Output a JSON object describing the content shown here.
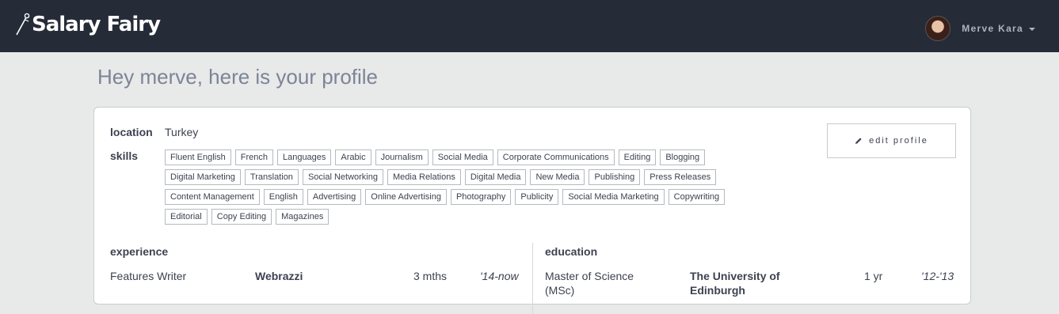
{
  "header": {
    "logo_text": "Salary Fairy",
    "user_name": "Merve Kara"
  },
  "page": {
    "title": "Hey merve, here is your profile"
  },
  "profile": {
    "location_label": "location",
    "location_value": "Turkey",
    "skills_label": "skills",
    "edit_button_label": "edit profile",
    "skills": [
      "Fluent English",
      "French",
      "Languages",
      "Arabic",
      "Journalism",
      "Social Media",
      "Corporate Communications",
      "Editing",
      "Blogging",
      "Digital Marketing",
      "Translation",
      "Social Networking",
      "Media Relations",
      "Digital Media",
      "New Media",
      "Publishing",
      "Press Releases",
      "Content Management",
      "English",
      "Advertising",
      "Online Advertising",
      "Photography",
      "Publicity",
      "Social Media Marketing",
      "Copywriting",
      "Editorial",
      "Copy Editing",
      "Magazines"
    ]
  },
  "experience": {
    "heading": "experience",
    "items": [
      {
        "title": "Features Writer",
        "company": "Webrazzi",
        "duration": "3 mths",
        "period": "'14-now"
      }
    ]
  },
  "education": {
    "heading": "education",
    "items": [
      {
        "degree": "Master of Science (MSc)",
        "school": "The University of Edinburgh",
        "duration": "1 yr",
        "period": "'12-'13"
      }
    ]
  }
}
